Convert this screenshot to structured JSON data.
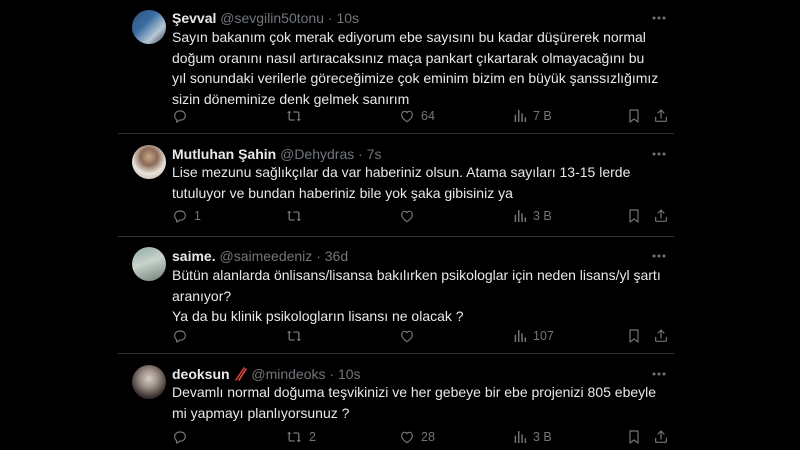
{
  "tweets": [
    {
      "name": "Şevval",
      "handle": "@sevgilin50tonu",
      "time": "10s",
      "text": "Sayın bakanım çok merak ediyorum ebe sayısını bu kadar düşürerek normal doğum oranını nasıl artıracaksınız maça pankart çıkartarak olmayacağını bu yıl sonundaki verilerle göreceğimize çok eminim bizim en büyük şanssızlığımız sizin döneminize denk gelmek sanırım",
      "replies": "",
      "retweets": "",
      "likes": "64",
      "views": "7 B"
    },
    {
      "name": "Mutluhan Şahin",
      "handle": "@Dehydras",
      "time": "7s",
      "text": "Lise mezunu sağlıkçılar da var haberiniz olsun. Atama sayıları 13-15 lerde tutuluyor ve bundan haberiniz bile yok şaka gibisiniz ya",
      "replies": "1",
      "retweets": "",
      "likes": "",
      "views": "3 B"
    },
    {
      "name": "saime.",
      "handle": "@saimeedeniz",
      "time": "36d",
      "text": "Bütün alanlarda önlisans/lisansa bakılırken psikologlar için neden lisans/yl şartı aranıyor?\nYa da bu klinik psikologların lisansı ne olacak ?",
      "replies": "",
      "retweets": "",
      "likes": "",
      "views": "107"
    },
    {
      "name": "deoksun",
      "handle": "@mindeoks",
      "time": "10s",
      "text": "Devamlı normal doğuma teşvikinizi ve her gebeye bir ebe projenizi 805 ebeyle mi yapmayı planlıyorsunuz ?",
      "replies": "",
      "retweets": "2",
      "likes": "28",
      "views": "3 B"
    }
  ],
  "separator": "·",
  "icons": {
    "reply": "reply-icon",
    "retweet": "retweet-icon",
    "like": "heart-icon",
    "views": "views-chart-icon",
    "bookmark": "bookmark-icon",
    "share": "share-icon",
    "more": "more-dots-icon",
    "name_emoji": "chopsticks-emoji"
  },
  "colors": {
    "background": "#000000",
    "text": "#e7e9ea",
    "muted": "#71767b",
    "divider": "#2f3336"
  }
}
